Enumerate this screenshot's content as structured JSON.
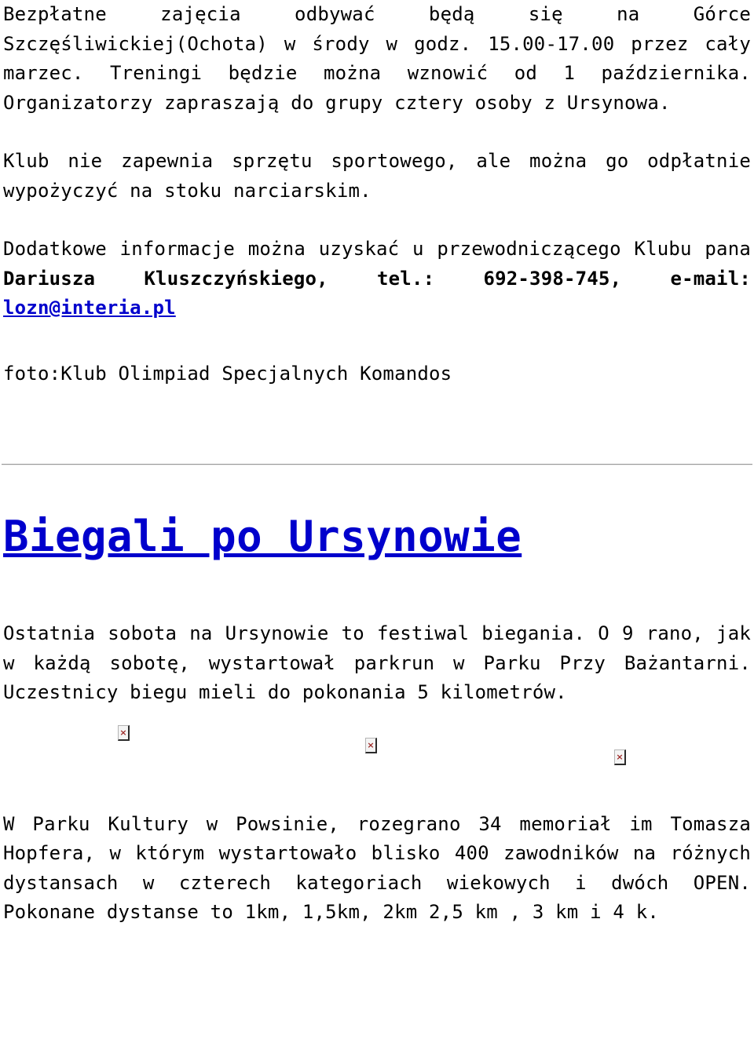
{
  "document": {
    "paragraphs": {
      "intro_1": "Bezpłatne zajęcia odbywać będą się na Górce Szczęśliwickiej(Ochota) w środy w godz. 15.00-17.00  przez cały marzec. Treningi będzie można wznowić od  1 października. Organizatorzy zapraszają do grupy cztery  osoby z Ursynowa.",
      "intro_2": "Klub nie zapewnia sprzętu sportowego, ale  można  go odpłatnie  wypożyczyć na stoku narciarskim.",
      "contact_prefix": "Dodatkowe informacje można uzyskać u przewodniczącego Klubu pana ",
      "contact_bold": "Dariusza Kluszczyńskiego, tel.: 692-398-745,  e-mail:",
      "contact_email": "lozn@interia.pl",
      "photo_credit": "foto:Klub Olimpiad Specjalnych Komandos"
    },
    "article": {
      "heading": "Biegali po Ursynowie",
      "lead": "Ostatnia sobota na Ursynowie to festiwal biegania.  O 9 rano, jak w każdą sobotę,   wystartował parkrun w  Parku  Przy Bażantarni. Uczestnicy biegu  mieli  do pokonania 5 kilometrów.",
      "body": "W Parku Kultury w Powsinie, rozegrano 34 memoriał im Tomasza Hopfera, w którym wystartowało blisko 400 zawodników na różnych dystansach w czterech kategoriach wiekowych i dwóch OPEN. Pokonane dystanse to 1km, 1,5km, 2km 2,5 km , 3 km i 4 k."
    },
    "images": [
      {
        "alt_glyph": "×",
        "name": "broken-image-1"
      },
      {
        "alt_glyph": "×",
        "name": "broken-image-2"
      },
      {
        "alt_glyph": "×",
        "name": "broken-image-3"
      }
    ],
    "colors": {
      "link": "#0000cc",
      "text": "#000000",
      "background": "#ffffff",
      "divider": "#999999",
      "broken_image_x": "#9e2b29"
    }
  }
}
